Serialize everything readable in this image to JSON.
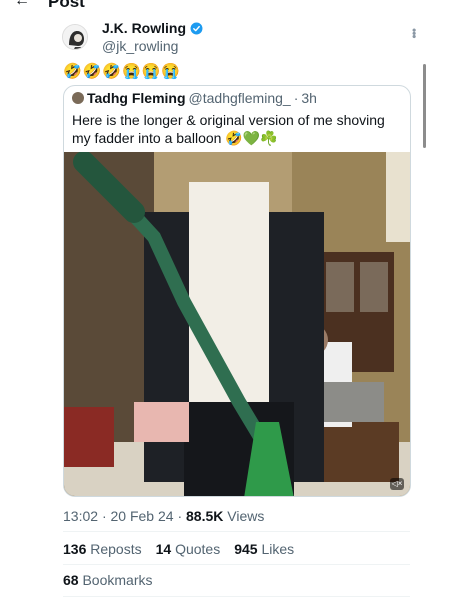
{
  "header": {
    "title": "Post"
  },
  "tweet": {
    "author_name": "J.K. Rowling",
    "author_handle": "@jk_rowling",
    "text": "🤣🤣🤣😭😭😭"
  },
  "quote": {
    "name": "Tadhg Fleming",
    "handle": "@tadhgfleming_",
    "time": "3h",
    "text": "Here is the longer & original version of me shoving my fadder into a balloon 🤣💚☘️"
  },
  "meta": {
    "time": "13:02",
    "date": "20 Feb 24",
    "views_count": "88.5K",
    "views_label": "Views"
  },
  "stats": {
    "reposts_count": "136",
    "reposts_label": "Reposts",
    "quotes_count": "14",
    "quotes_label": "Quotes",
    "likes_count": "945",
    "likes_label": "Likes",
    "bookmarks_count": "68",
    "bookmarks_label": "Bookmarks"
  },
  "colors": {
    "text_primary": "#0f1419",
    "text_secondary": "#536471",
    "verified": "#1d9bf0",
    "border": "#cfd9de"
  },
  "icons": {
    "back": "arrow-left",
    "verified": "verified-badge",
    "more": "more-dots",
    "mute": "speaker-muted"
  }
}
